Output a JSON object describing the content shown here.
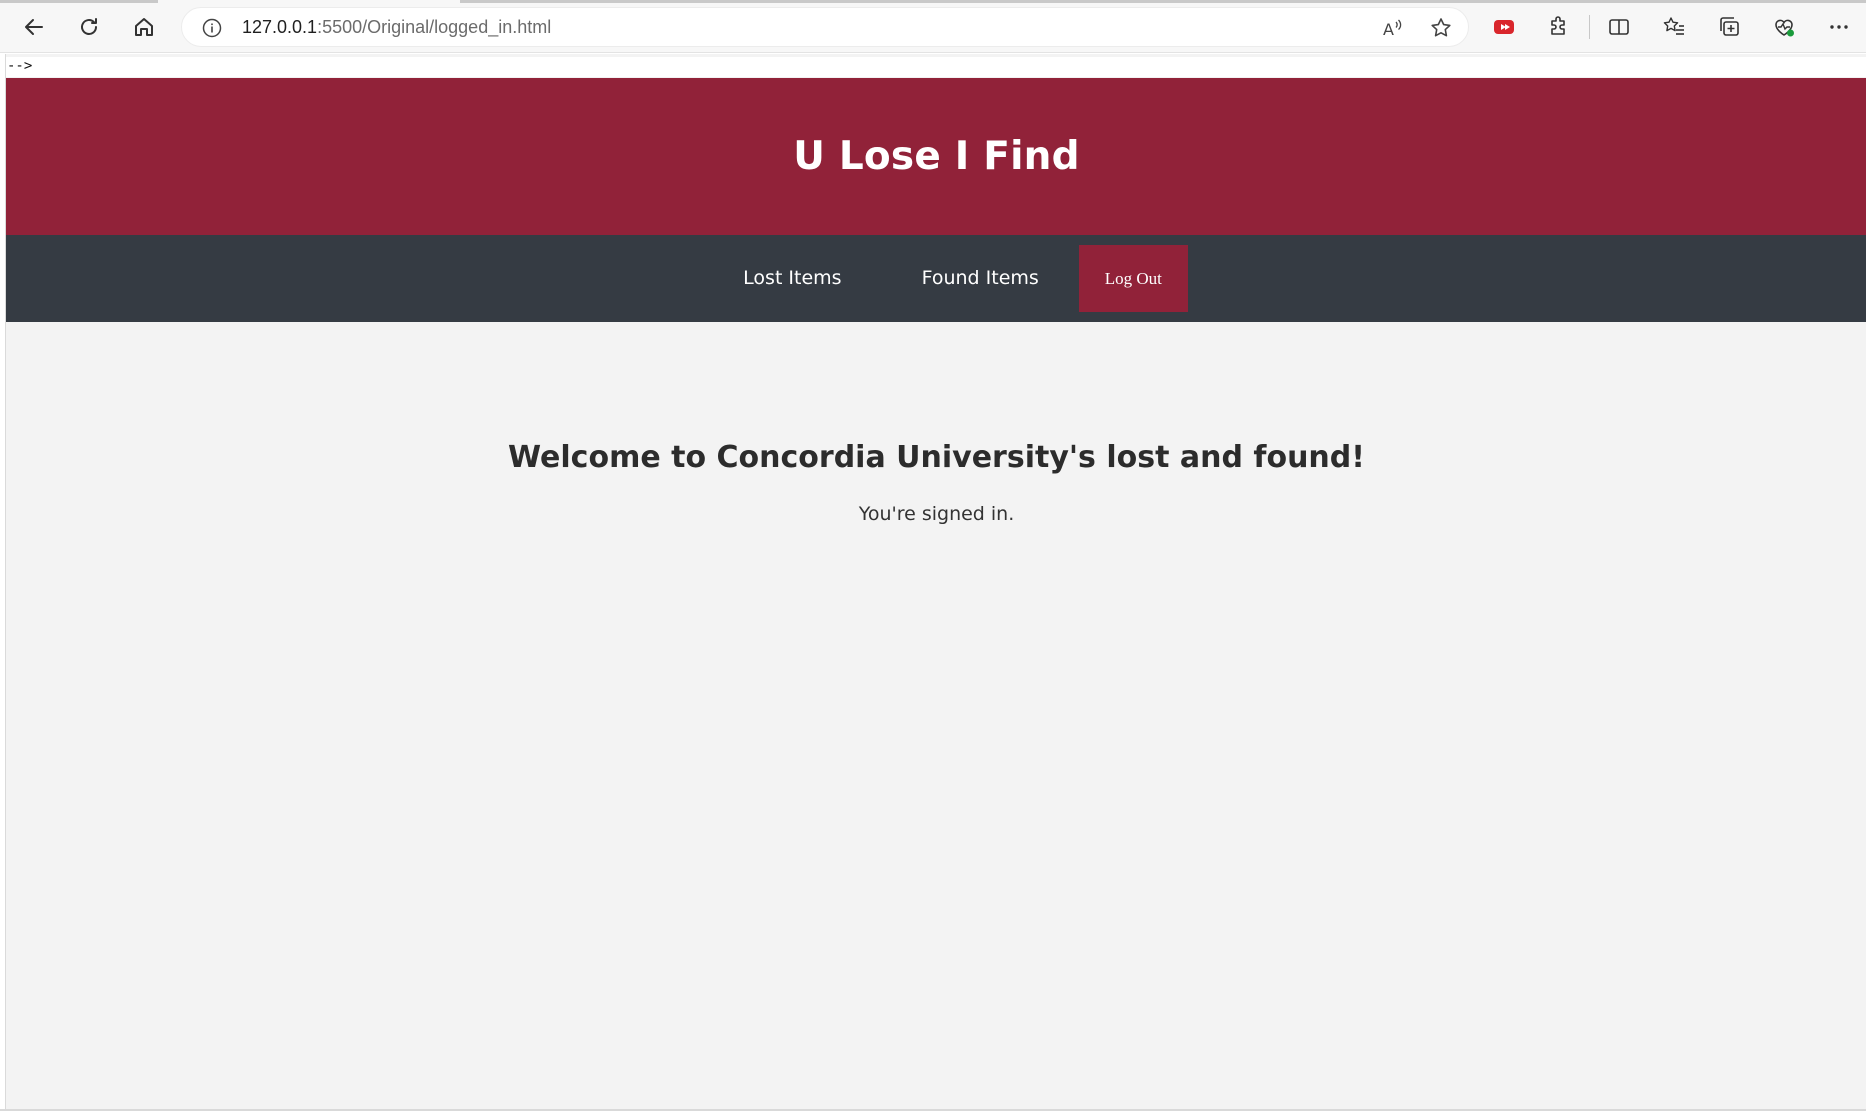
{
  "browser": {
    "url_host": "127.0.0.1",
    "url_path": ":5500/Original/logged_in.html",
    "icons": {
      "back": "back-arrow-icon",
      "reload": "reload-icon",
      "home": "home-icon",
      "info": "info-icon",
      "read_aloud": "read-aloud-icon",
      "favorite": "star-icon",
      "extension_red": "video-extension-icon",
      "extensions": "puzzle-icon",
      "split_screen": "split-screen-icon",
      "favorites": "favorites-list-icon",
      "collections": "collections-icon",
      "health": "browser-essentials-icon",
      "more": "more-icon"
    },
    "colors": {
      "extension_red": "#d9262c",
      "health_green": "#1a9b3c"
    }
  },
  "page": {
    "stray_text": "-->",
    "site_title": "U Lose I Find",
    "nav": {
      "lost_items": "Lost Items",
      "found_items": "Found Items",
      "log_out": "Log Out"
    },
    "welcome_heading": "Welcome to Concordia University's lost and found!",
    "status_text": "You're signed in.",
    "colors": {
      "header_bg": "#912239",
      "nav_bg": "#353b43",
      "page_bg": "#f3f3f3",
      "logout_bg": "#912239"
    }
  }
}
